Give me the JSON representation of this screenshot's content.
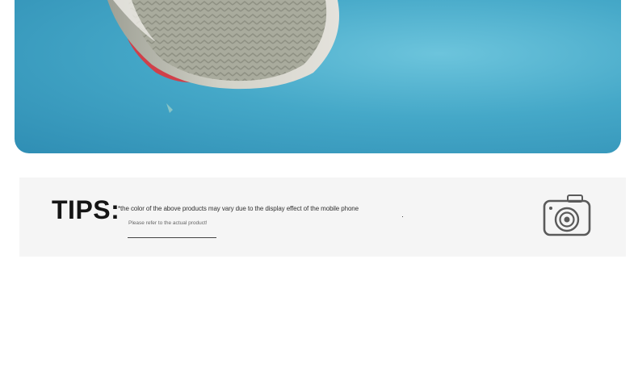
{
  "colors": {
    "photo_background": "#45a8c8",
    "card_background": "#f5f5f5",
    "heading_text": "#151515"
  },
  "tips": {
    "heading": "TIPS:",
    "disclaimer": "*the color of the above products may vary due to the display effect of the mobile phone",
    "note": "Please refer to the actual product!",
    "icon": "camera-icon"
  }
}
